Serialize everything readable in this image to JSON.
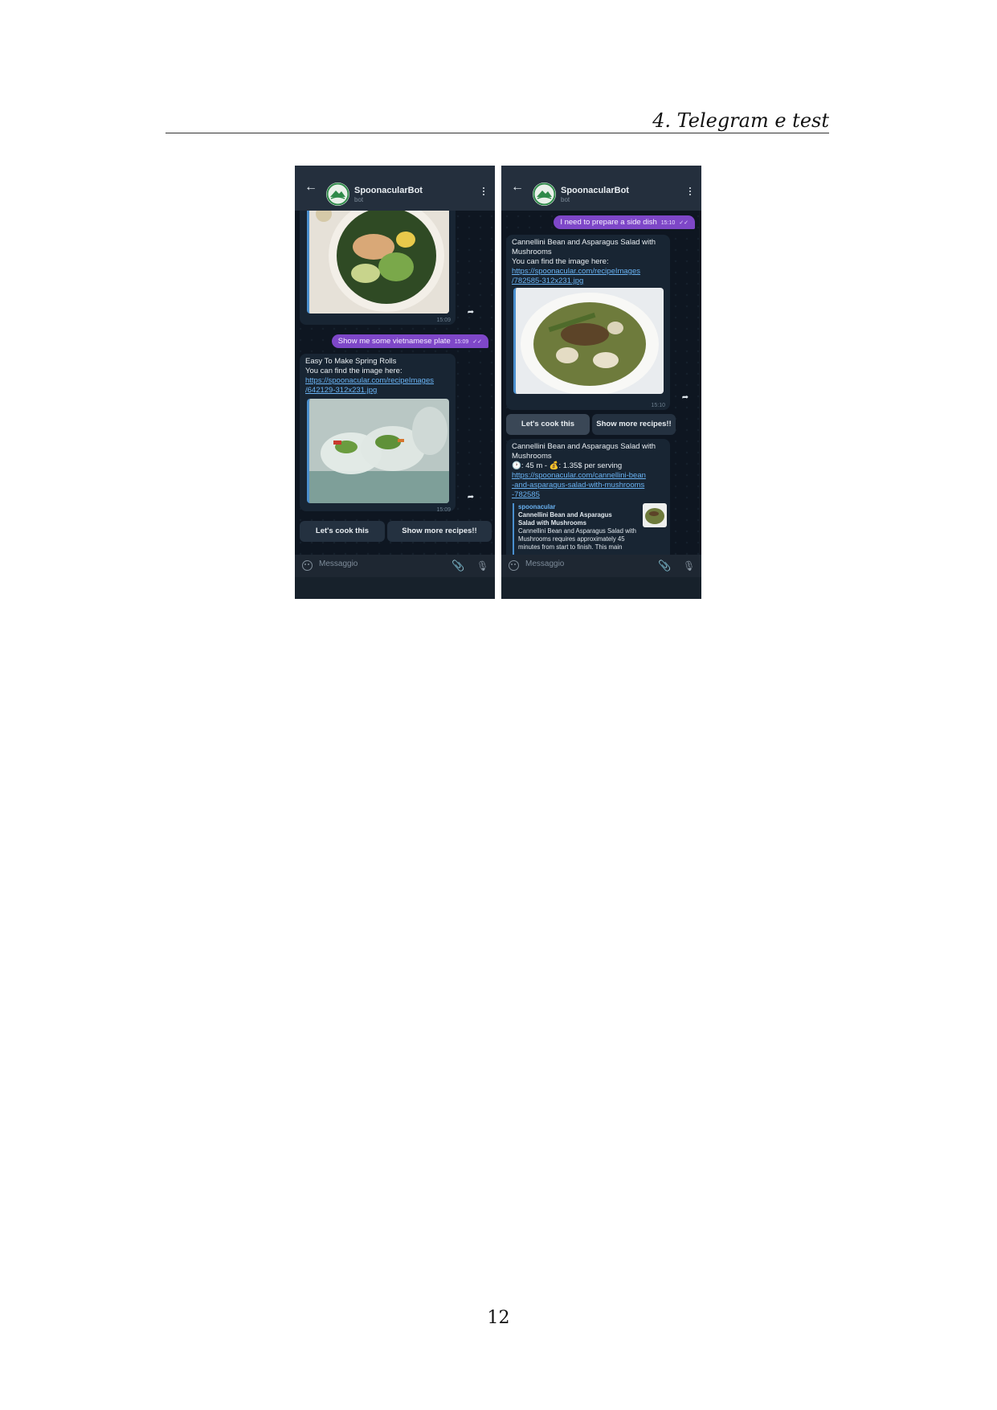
{
  "page": {
    "running_head": "4. Telegram e test",
    "page_number": "12"
  },
  "left": {
    "header": {
      "name": "SpoonacularBot",
      "subtitle": "bot"
    },
    "photo1_time": "15:09",
    "user_message": {
      "text": "Show me some vietnamese plate",
      "time": "15:09"
    },
    "recipe": {
      "title": "Easy To Make Spring Rolls",
      "line2": "You can find the image here:",
      "link1": "https://spoonacular.com/recipeImages",
      "link2": "/642129-312x231.jpg",
      "time": "15:09"
    },
    "buttons": {
      "cook": "Let's cook this",
      "more": "Show more recipes!!"
    },
    "input_placeholder": "Messaggio"
  },
  "right": {
    "header": {
      "name": "SpoonacularBot",
      "subtitle": "bot"
    },
    "user_message": {
      "text": "I need to prepare a side dish",
      "time": "15:10"
    },
    "recipe": {
      "title1": "Cannellini Bean and Asparagus Salad with",
      "title2": "Mushrooms",
      "line3": "You can find the image here:",
      "link1": "https://spoonacular.com/recipeImages",
      "link2": "/782585-312x231.jpg",
      "time": "15:10"
    },
    "buttons": {
      "cook": "Let's cook this",
      "more": "Show more recipes!!"
    },
    "detail": {
      "title1": "Cannellini Bean and Asparagus Salad with",
      "title2": "Mushrooms",
      "info": "🕐: 45 m - 💰: 1.35$ per serving",
      "link1": "https://spoonacular.com/cannellini-bean",
      "link2": "-and-asparagus-salad-with-mushrooms",
      "link3": "-782585"
    },
    "preview": {
      "site": "spoonacular",
      "title1": "Cannellini Bean and Asparagus",
      "title2": "Salad with Mushrooms",
      "desc1": "Cannellini Bean and Asparagus Salad with",
      "desc2": "Mushrooms requires approximately 45",
      "desc3": "minutes from start to finish. This main"
    },
    "input_placeholder": "Messaggio"
  }
}
